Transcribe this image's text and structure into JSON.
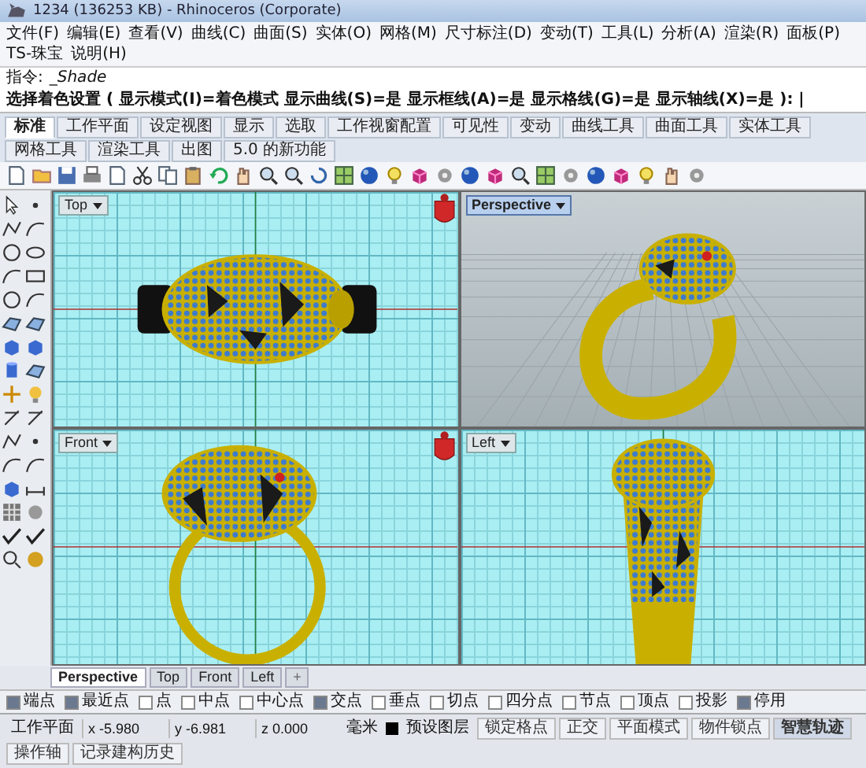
{
  "window": {
    "title": "1234 (136253 KB) - Rhinoceros (Corporate)"
  },
  "menu": [
    "文件(F)",
    "编辑(E)",
    "查看(V)",
    "曲线(C)",
    "曲面(S)",
    "实体(O)",
    "网格(M)",
    "尺寸标注(D)",
    "变动(T)",
    "工具(L)",
    "分析(A)",
    "渲染(R)",
    "面板(P)",
    "TS-珠宝",
    "说明(H)"
  ],
  "command": {
    "label": "指令:",
    "value": "_Shade"
  },
  "prompt": "选择着色设置 ( 显示模式(I)=着色模式  显示曲线(S)=是  显示框线(A)=是  显示格线(G)=是  显示轴线(X)=是 ): |",
  "toolbar_tabs": [
    {
      "label": "标准",
      "selected": true
    },
    {
      "label": "工作平面",
      "selected": false
    },
    {
      "label": "设定视图",
      "selected": false
    },
    {
      "label": "显示",
      "selected": false
    },
    {
      "label": "选取",
      "selected": false
    },
    {
      "label": "工作视窗配置",
      "selected": false
    },
    {
      "label": "可见性",
      "selected": false
    },
    {
      "label": "变动",
      "selected": false
    },
    {
      "label": "曲线工具",
      "selected": false
    },
    {
      "label": "曲面工具",
      "selected": false
    },
    {
      "label": "实体工具",
      "selected": false
    },
    {
      "label": "网格工具",
      "selected": false
    },
    {
      "label": "渲染工具",
      "selected": false
    },
    {
      "label": "出图",
      "selected": false
    },
    {
      "label": "5.0 的新功能",
      "selected": false
    }
  ],
  "viewports": [
    {
      "title": "Top",
      "kind": "top",
      "active": false
    },
    {
      "title": "Perspective",
      "kind": "perspective",
      "active": true
    },
    {
      "title": "Front",
      "kind": "front",
      "active": false
    },
    {
      "title": "Left",
      "kind": "left",
      "active": false
    }
  ],
  "viewport_tabs": [
    {
      "label": "Perspective",
      "selected": true
    },
    {
      "label": "Top",
      "selected": false
    },
    {
      "label": "Front",
      "selected": false
    },
    {
      "label": "Left",
      "selected": false
    }
  ],
  "add_tab": "+",
  "osnaps": [
    {
      "label": "端点",
      "checked": true
    },
    {
      "label": "最近点",
      "checked": true
    },
    {
      "label": "点",
      "checked": false
    },
    {
      "label": "中点",
      "checked": false
    },
    {
      "label": "中心点",
      "checked": false
    },
    {
      "label": "交点",
      "checked": true
    },
    {
      "label": "垂点",
      "checked": false
    },
    {
      "label": "切点",
      "checked": false
    },
    {
      "label": "四分点",
      "checked": false
    },
    {
      "label": "节点",
      "checked": false
    },
    {
      "label": "顶点",
      "checked": false
    },
    {
      "label": "投影",
      "checked": false
    },
    {
      "label": "停用",
      "checked": true
    }
  ],
  "status_bar": {
    "plane": "工作平面",
    "x": "x -5.980",
    "y": "y -6.981",
    "z": "z 0.000",
    "units": "毫米",
    "layer": "预设图层",
    "toggles": [
      {
        "label": "锁定格点",
        "on": false
      },
      {
        "label": "正交",
        "on": false
      },
      {
        "label": "平面模式",
        "on": false
      },
      {
        "label": "物件锁点",
        "on": false
      },
      {
        "label": "智慧轨迹",
        "on": true
      },
      {
        "label": "操作轴",
        "on": false
      },
      {
        "label": "记录建构历史",
        "on": false
      }
    ]
  }
}
